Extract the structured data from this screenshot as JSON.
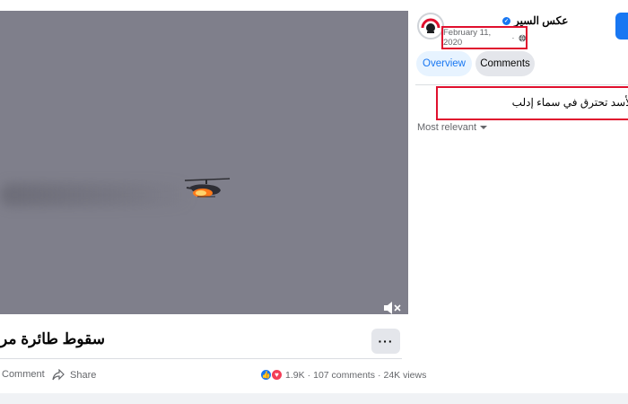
{
  "video": {
    "subject": "helicopter-on-fire",
    "mute_icon": "speaker-muted-icon"
  },
  "post": {
    "title": "سقوط طائرة مر",
    "more_label": "···",
    "actions": {
      "comment_label": "Comment",
      "share_label": "Share"
    },
    "stats": {
      "reactions": "1.9K",
      "separator": "·",
      "comments": "107 comments",
      "views": "24K views"
    }
  },
  "panel": {
    "page_name": "عكس السير",
    "date": "February 11, 2020",
    "audience_icon": "globe-icon",
    "tabs": [
      "Overview",
      "Comments"
    ],
    "active_tab": "Comments",
    "caption": "لأسد تحترق في سماء إدلب",
    "sort_label": "Most relevant"
  },
  "colors": {
    "accent": "#1877f2",
    "highlight_box": "#e0102e",
    "video_bg": "#7f7f8b"
  }
}
